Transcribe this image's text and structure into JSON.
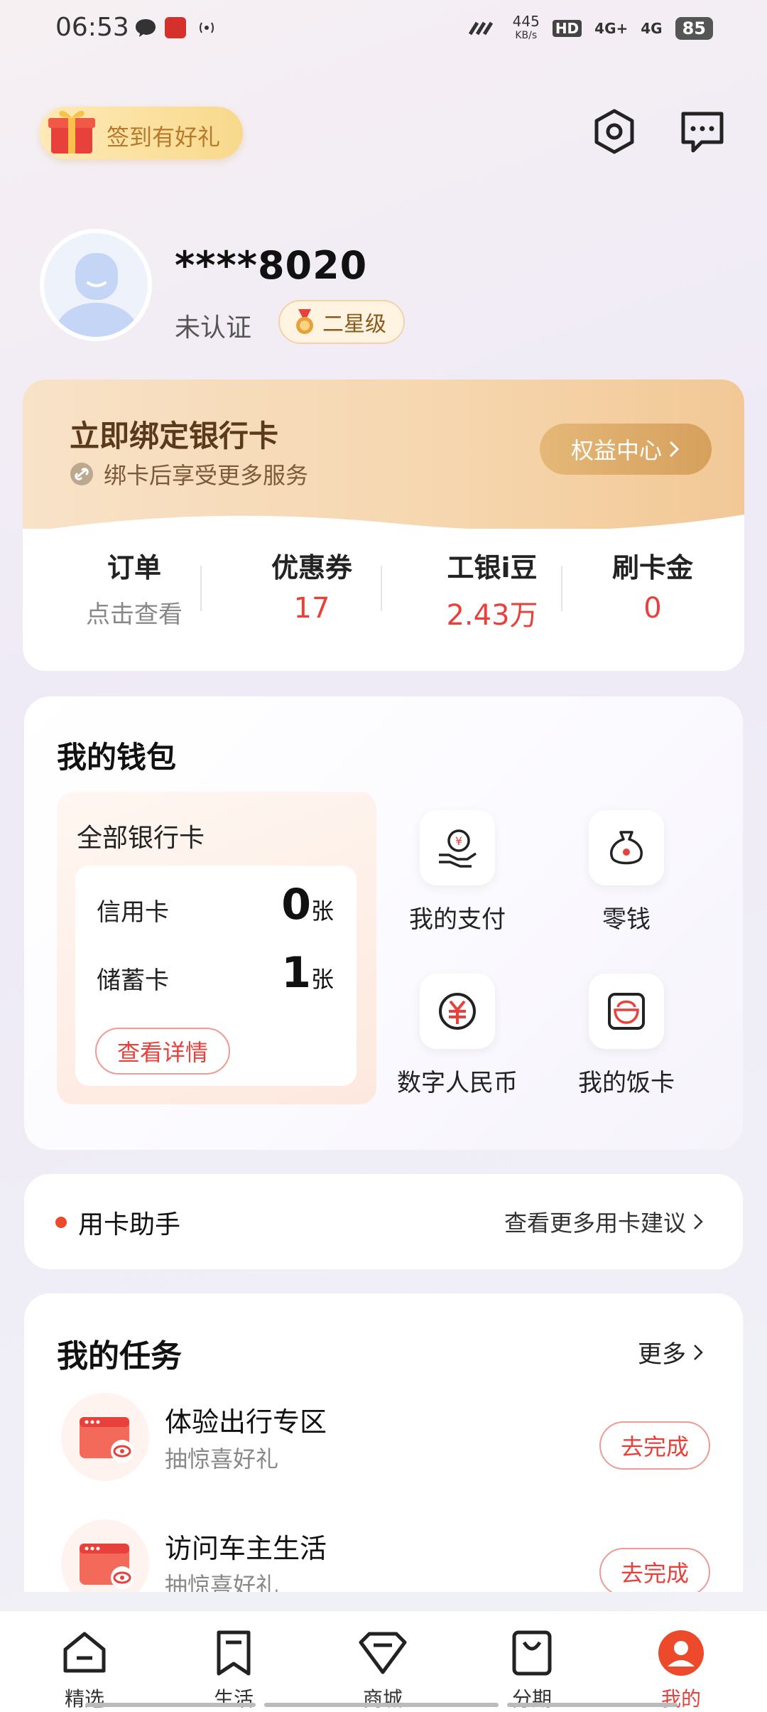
{
  "status_bar": {
    "time": "06:53",
    "net_speed_value": "445",
    "net_speed_unit": "KB/s",
    "hd": "HD",
    "sim1": "4G+",
    "sim2": "4G",
    "battery": "85"
  },
  "header": {
    "signin_label": "签到有好礼"
  },
  "profile": {
    "username": "****8020",
    "auth_status": "未认证",
    "level": "二星级"
  },
  "bind_card": {
    "title": "立即绑定银行卡",
    "subtitle": "绑卡后享受更多服务",
    "benefit_button": "权益中心",
    "stats": [
      {
        "label": "订单",
        "value": "点击查看"
      },
      {
        "label": "优惠券",
        "value": "17"
      },
      {
        "label": "工银i豆",
        "value": "2.43万"
      },
      {
        "label": "刷卡金",
        "value": "0"
      }
    ]
  },
  "wallet": {
    "title": "我的钱包",
    "all_cards_title": "全部银行卡",
    "credit_label": "信用卡",
    "credit_count": "0",
    "debit_label": "储蓄卡",
    "debit_count": "1",
    "count_unit": "张",
    "detail_button": "查看详情",
    "shortcuts": [
      {
        "label": "我的支付",
        "icon": "pay-hand-icon"
      },
      {
        "label": "零钱",
        "icon": "money-bag-icon"
      },
      {
        "label": "数字人民币",
        "icon": "digital-rmb-icon"
      },
      {
        "label": "我的饭卡",
        "icon": "meal-card-icon"
      }
    ]
  },
  "assistant": {
    "title": "用卡助手",
    "more_link": "查看更多用卡建议"
  },
  "tasks": {
    "title": "我的任务",
    "more_link": "更多",
    "items": [
      {
        "title": "体验出行专区",
        "subtitle": "抽惊喜好礼",
        "button": "去完成"
      },
      {
        "title": "访问车主生活",
        "subtitle": "抽惊喜好礼",
        "button": "去完成"
      }
    ]
  },
  "bottom_nav": {
    "items": [
      {
        "label": "精选",
        "icon": "home-icon"
      },
      {
        "label": "生活",
        "icon": "bookmark-icon"
      },
      {
        "label": "商城",
        "icon": "diamond-icon"
      },
      {
        "label": "分期",
        "icon": "shopping-bag-icon"
      },
      {
        "label": "我的",
        "icon": "profile-icon"
      }
    ],
    "active_index": 4
  },
  "colors": {
    "accent_red": "#e8413b",
    "gold": "#d6a05c"
  }
}
